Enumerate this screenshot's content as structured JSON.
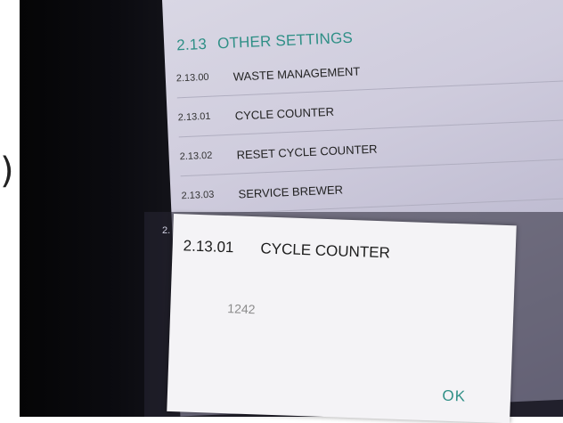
{
  "section": {
    "number": "2.13",
    "title": "OTHER SETTINGS"
  },
  "rows": [
    {
      "code": "2.13.00",
      "label": "WASTE MANAGEMENT"
    },
    {
      "code": "2.13.01",
      "label": "CYCLE COUNTER"
    },
    {
      "code": "2.13.02",
      "label": "RESET CYCLE COUNTER"
    },
    {
      "code": "2.13.03",
      "label": "SERVICE BREWER"
    }
  ],
  "peek_text": "2.",
  "edge_glyph": ")",
  "dialog": {
    "code": "2.13.01",
    "title": "CYCLE COUNTER",
    "value": "1242",
    "ok_label": "OK"
  },
  "colors": {
    "accent": "#2f8f86",
    "dialog_bg": "#f4f3f6",
    "screen_bg": "#cfccdd"
  }
}
